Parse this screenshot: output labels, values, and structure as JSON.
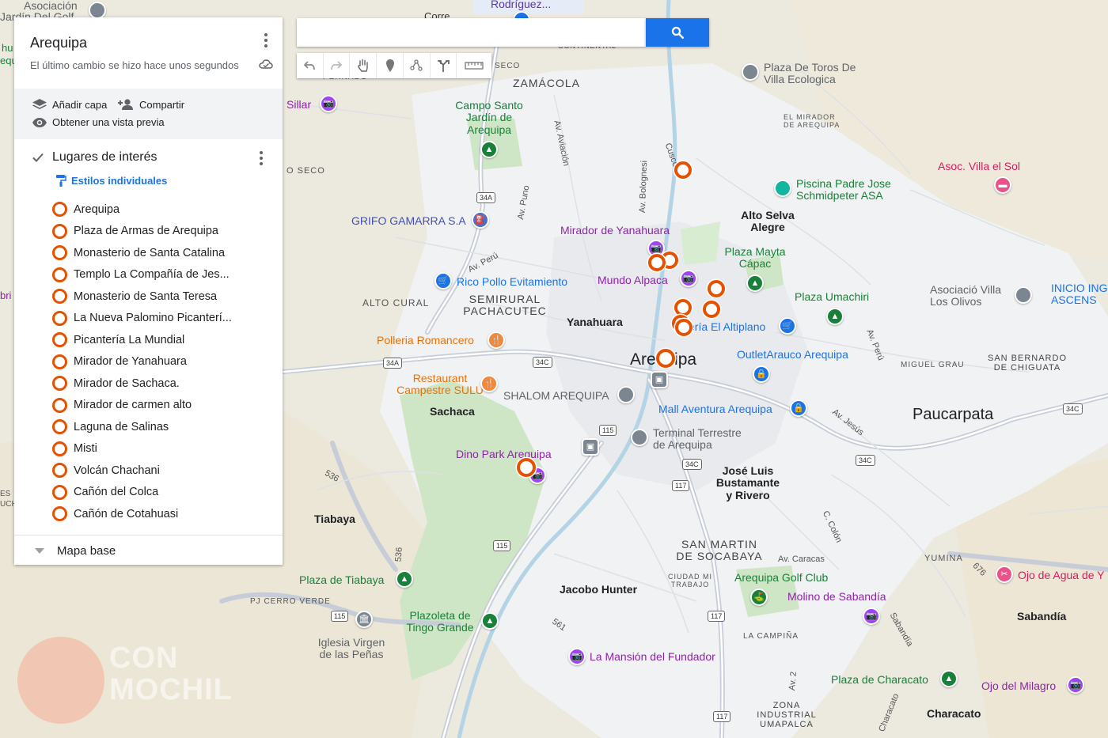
{
  "panel": {
    "title": "Arequipa",
    "subtitle": "El último cambio se hizo hace unos segundos",
    "actions": {
      "add_layer": "Añadir capa",
      "share": "Compartir",
      "preview": "Obtener una vista previa"
    },
    "layer": {
      "name": "Lugares de interés",
      "styles": "Estilos individuales",
      "places": [
        "Arequipa",
        "Plaza de Armas de Arequipa",
        "Monasterio de Santa Catalina",
        "Templo La Compañía de Jes...",
        "Monasterio de Santa Teresa",
        "La Nueva Palomino Picanterí...",
        "Picantería La Mundial",
        "Mirador de Yanahuara",
        "Mirador de Sachaca.",
        "Mirador de carmen alto",
        "Laguna de Salinas",
        "Misti",
        "Volcán Chachani",
        "Cañón del Colca",
        "Cañón de Cotahuasi"
      ]
    },
    "basemap": "Mapa base"
  },
  "search": {
    "value": ""
  },
  "toolbar": [
    "undo-icon",
    "redo-icon",
    "hand-icon",
    "marker-icon",
    "draw-line-icon",
    "route-icon",
    "ruler-icon"
  ],
  "map_labels": {
    "asociacion": "Asociación",
    "jardin_del_golf": "Jardín Del Golf",
    "rodriguez": "Rodríguez...",
    "corre": "Corre",
    "continental": "CONTINENTAL",
    "seco_top": "SECO",
    "pendido": "PERNADO",
    "zamacola": "ZAMÁCOLA",
    "sillar": "Sillar",
    "seco_left": "O SECO",
    "campo_santo": "Campo Santo\nJardín de\nArequipa",
    "av_aviacion": "Av. Aviación",
    "av_bolognesi": "Av. Bolognesi",
    "cusco": "Cusco",
    "plaza_toros": "Plaza De Toros De\nVilla Ecologica",
    "el_mirador": "EL MIRADOR\nDE AREQUIPA",
    "asoc_villa_sol": "Asoc. Villa el Sol",
    "piscina": "Piscina Padre Jose\nSchmidpeter ASA",
    "alto_selva": "Alto Selva\nAlegre",
    "grifo": "GRIFO GAMARRA S.A",
    "av_puno": "Av. Puno",
    "mirador_yanahuara": "Mirador de Yanahuara",
    "plaza_mayta": "Plaza Mayta\nCápac",
    "av_peru": "Av. Perú",
    "rico_pollo": "Rico Pollo Evitamiento",
    "mundo_alpaca": "Mundo Alpaca",
    "asociacio_villa": "Asociació Villa\nLos Olivos",
    "inicio_ing": "INICIO ING\nASCENS",
    "plaza_umachiri": "Plaza Umachiri",
    "alto_cural": "ALTO CURAL",
    "semirural": "SEMIRURAL\nPACHACUTEC",
    "yanahuara": "Yanahuara",
    "altiplano": "ería El Altiplano",
    "av_peru_e": "Av. Perú",
    "polleria": "Polleria Romancero",
    "arequipa_city": "Arequipa",
    "outlet": "OutletArauco Arequipa",
    "miguel_grau": "MIGUEL GRAU",
    "san_bernardo": "SAN BERNARDO\nDE CHIGUATA",
    "restaurant": "Restaurant\nCampestre SULU",
    "shalom": "SHALOM AREQUIPA",
    "sachaca": "Sachaca",
    "mall_aventura": "Mall Aventura Arequipa",
    "av_jesus": "Av. Jesús",
    "paucarpata": "Paucarpata",
    "terminal": "Terminal Terrestre\nde Arequipa",
    "dino_park": "Dino Park Arequipa",
    "jose_luis": "José Luis\nBustamante\ny Rivero",
    "c_colon": "C. Colón",
    "tiabaya": "Tiabaya",
    "san_martin": "SAN MARTIN\nDE SOCABAYA",
    "av_caracas": "Av. Caracas",
    "yumina": "YUMINA",
    "ojo_agua": "Ojo de Agua de Y",
    "ciudad_mi_trabajo": "CIUDAD MI\nTRABAJO",
    "arequipa_golf": "Arequipa Golf Club",
    "plaza_tiabaya": "Plaza de Tiabaya",
    "pj_cerro_verde": "PJ CERRO VERDE",
    "jacobo_hunter": "Jacobo Hunter",
    "molino": "Molino de Sabandía",
    "sabandia_road": "Sabandía",
    "sabandia": "Sabandía",
    "plazoleta": "Plazoleta de\nTingo Grande",
    "la_campina": "LA CAMPIÑA",
    "iglesia": "Iglesia Virgen\nde las Peñas",
    "la_mansion": "La Mansión del Fundador",
    "plaza_characato": "Plaza de Characato",
    "ojo_milagro": "Ojo del Milagro",
    "zona_industrial": "ZONA\nINDUSTRIAL\nUMAPALCA",
    "characato": "Characato",
    "characato_road": "Characato",
    "av_2": "Av. 2",
    "left_cut_1": "hu",
    "left_cut_2": "equ",
    "left_cut_3": "bri",
    "left_cut_4": "ES",
    "left_cut_5": "UCH",
    "r_536": "536",
    "r_561": "561",
    "r_676": "676",
    "r_34a_1": "34A",
    "r_34a_2": "34A",
    "r_34c_1": "34C",
    "r_34c_2": "34C",
    "r_34c_3": "34C",
    "r_34c_4": "34C",
    "r_115_1": "115",
    "r_115_2": "115",
    "r_115_3": "115",
    "r_117_1": "117",
    "r_117_2": "117",
    "r_117_3": "117",
    "watermark": "CON\nMOCHIL"
  },
  "colors": {
    "accent": "#1a73e8",
    "pin": "#e65100",
    "park": "#c8e6c9",
    "road": "#ffffff",
    "highway": "#aab4c4"
  }
}
